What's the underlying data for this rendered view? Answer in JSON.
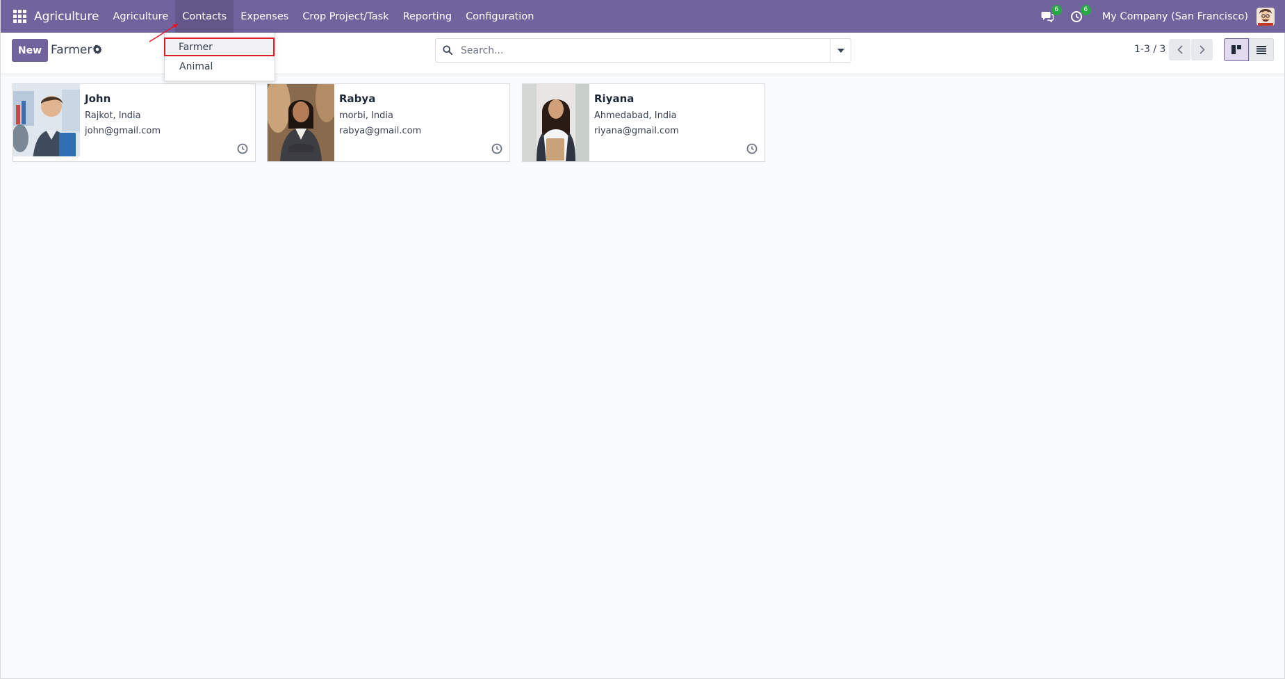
{
  "navbar": {
    "app_title": "Agriculture",
    "menu": [
      {
        "label": "Agriculture"
      },
      {
        "label": "Contacts",
        "active": true
      },
      {
        "label": "Expenses"
      },
      {
        "label": "Crop Project/Task"
      },
      {
        "label": "Reporting"
      },
      {
        "label": "Configuration"
      }
    ],
    "messages_badge": "6",
    "activities_badge": "6",
    "company": "My Company (San Francisco)",
    "accent_color": "#71639e"
  },
  "control_panel": {
    "new_label": "New",
    "title": "Farmer",
    "search_placeholder": "Search...",
    "pager": "1-3 / 3"
  },
  "dropdown": {
    "items": [
      {
        "label": "Farmer"
      },
      {
        "label": "Animal"
      }
    ]
  },
  "cards": [
    {
      "name": "John",
      "location": "Rajkot, India",
      "email": "john@gmail.com"
    },
    {
      "name": "Rabya",
      "location": "morbi, India",
      "email": "rabya@gmail.com"
    },
    {
      "name": "Riyana",
      "location": "Ahmedabad, India",
      "email": "riyana@gmail.com"
    }
  ]
}
